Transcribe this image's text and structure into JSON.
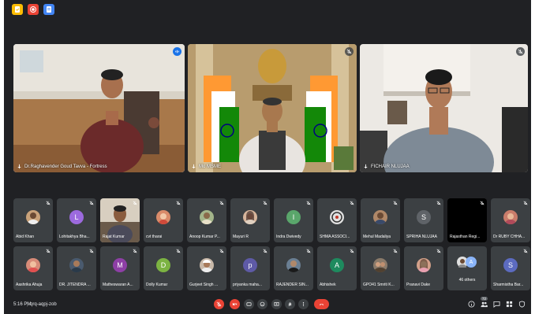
{
  "app_icons": [
    {
      "name": "tasks-app-icon",
      "color": "#fbbc04"
    },
    {
      "name": "record-app-icon",
      "color": "#ea4335"
    },
    {
      "name": "docs-app-icon",
      "color": "#4285f4"
    }
  ],
  "featured": [
    {
      "name": "Dr.Raghavender Goud Tavva - Fortress",
      "speaking": true
    },
    {
      "name": "Mo MSME",
      "speaking": false
    },
    {
      "name": "FICHAIR NLUJAA",
      "speaking": false
    }
  ],
  "participants_row1": [
    {
      "name": "Abid Khan",
      "initial": "",
      "color": "#c9a27a"
    },
    {
      "name": "Lohitakhya Bha...",
      "initial": "L",
      "color": "#9c6ade"
    },
    {
      "name": "Rajat Kumar",
      "initial": "",
      "color": "#8a6e4b"
    },
    {
      "name": "cvt tharai",
      "initial": "",
      "color": "#d98b6a"
    },
    {
      "name": "Anoop Kumar P...",
      "initial": "",
      "color": "#a3b58a"
    },
    {
      "name": "Mayuri R",
      "initial": "",
      "color": "#d7b59b"
    },
    {
      "name": "Indra Dwivedy",
      "initial": "I",
      "color": "#5aa66b"
    },
    {
      "name": "SHMA ASSOCI...",
      "initial": "",
      "color": "#e0e0e0"
    },
    {
      "name": "Mehul Madaliya",
      "initial": "",
      "color": "#b08868"
    },
    {
      "name": "SPRIHA NLUJAA",
      "initial": "S",
      "color": "#5f6368"
    },
    {
      "name": "Rajasthan Regi...",
      "initial": "",
      "color": "#000000"
    },
    {
      "name": "Dr RUBY CHHA...",
      "initial": "",
      "color": "#c97c6a"
    }
  ],
  "participants_row2": [
    {
      "name": "Aashrika Ahuja",
      "initial": "",
      "color": "#d78b78"
    },
    {
      "name": "DR. JITENDRA ...",
      "initial": "",
      "color": "#4a5a6e"
    },
    {
      "name": "Matheswaran A...",
      "initial": "M",
      "color": "#8e3fa6"
    },
    {
      "name": "Dolly Kumar",
      "initial": "D",
      "color": "#7cb342"
    },
    {
      "name": "Gurjeet Singh ...",
      "initial": "",
      "color": "#c8b8a8"
    },
    {
      "name": "priyanka maha...",
      "initial": "p",
      "color": "#5e5aa6"
    },
    {
      "name": "RAJENDER SIN...",
      "initial": "",
      "color": "#6b7f93"
    },
    {
      "name": "Abhishek",
      "initial": "A",
      "color": "#1e8a5e"
    },
    {
      "name": "GPO41 Smriti K...",
      "initial": "",
      "color": "#8a7a6a"
    },
    {
      "name": "Pranavi Dake",
      "initial": "",
      "color": "#d3a08a"
    },
    {
      "name": "46 others",
      "initial": "A",
      "color": "#8ab4f8"
    },
    {
      "name": "Sharmistha Bar...",
      "initial": "S",
      "color": "#5c6bc0"
    }
  ],
  "bottom_bar": {
    "time": "5:16 PM",
    "separator": "|",
    "meeting_code": "qrq-aqpj-zob",
    "participant_count": "72"
  }
}
